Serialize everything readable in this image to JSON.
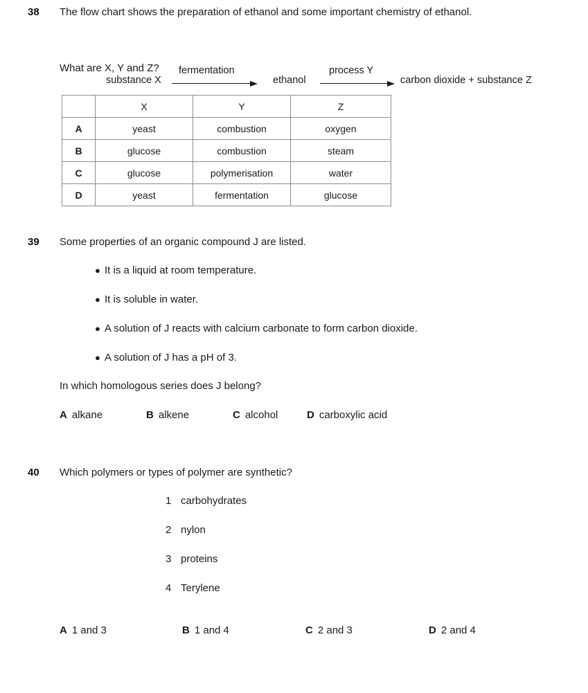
{
  "questions": [
    {
      "number": "38",
      "stem": "The flow chart shows the preparation of ethanol and some important chemistry of ethanol.",
      "follow_up": "What are X, Y and Z?",
      "flow_chart": {
        "substance_x": "substance X",
        "arrow1_label": "fermentation",
        "ethanol": "ethanol",
        "arrow2_label": "process Y",
        "products": "carbon dioxide  +  substance Z"
      },
      "table": {
        "headers": [
          "",
          "X",
          "Y",
          "Z"
        ],
        "rows": [
          {
            "key": "A",
            "x": "yeast",
            "y": "combustion",
            "z": "oxygen"
          },
          {
            "key": "B",
            "x": "glucose",
            "y": "combustion",
            "z": "steam"
          },
          {
            "key": "C",
            "x": "glucose",
            "y": "polymerisation",
            "z": "water"
          },
          {
            "key": "D",
            "x": "yeast",
            "y": "fermentation",
            "z": "glucose"
          }
        ]
      }
    },
    {
      "number": "39",
      "stem": "Some properties of an organic compound J are listed.",
      "bullet_marker": "●",
      "bullets": [
        "It is a liquid at room temperature.",
        "It is soluble in water.",
        "A solution of J reacts with calcium carbonate to form carbon dioxide.",
        "A solution of J has a pH of 3."
      ],
      "follow_up": "In which homologous series does J belong?",
      "options": [
        {
          "key": "A",
          "label": "alkane"
        },
        {
          "key": "B",
          "label": "alkene"
        },
        {
          "key": "C",
          "label": "alcohol"
        },
        {
          "key": "D",
          "label": "carboxylic acid"
        }
      ]
    },
    {
      "number": "40",
      "stem": "Which polymers or types of polymer are synthetic?",
      "items": [
        {
          "n": "1",
          "label": "carbohydrates"
        },
        {
          "n": "2",
          "label": "nylon"
        },
        {
          "n": "3",
          "label": "proteins"
        },
        {
          "n": "4",
          "label": "Terylene"
        }
      ],
      "options": [
        {
          "key": "A",
          "label": "1 and 3"
        },
        {
          "key": "B",
          "label": "1 and 4"
        },
        {
          "key": "C",
          "label": "2 and 3"
        },
        {
          "key": "D",
          "label": "2 and 4"
        }
      ]
    }
  ]
}
